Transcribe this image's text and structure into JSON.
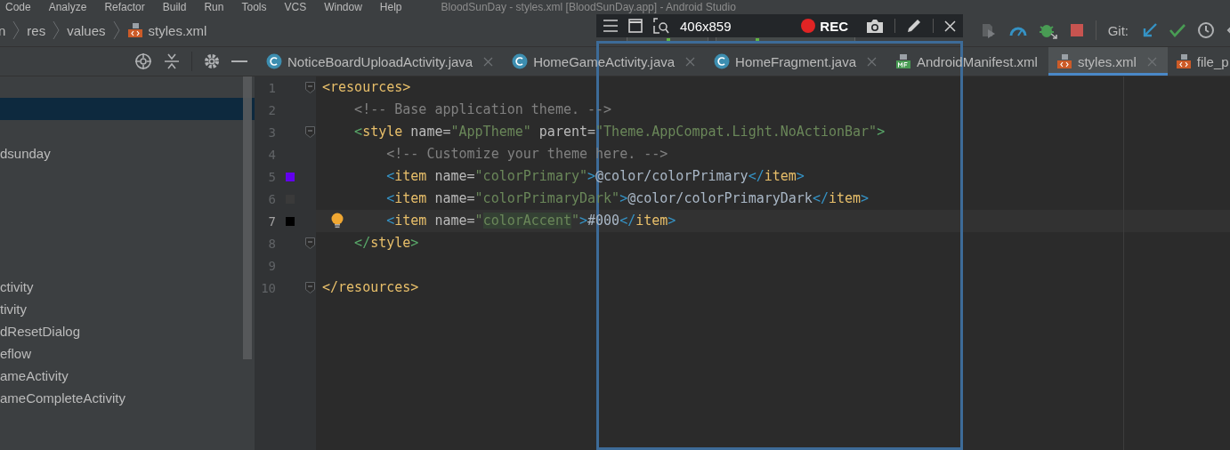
{
  "menu": [
    "Code",
    "Analyze",
    "Refactor",
    "Build",
    "Run",
    "Tools",
    "VCS",
    "Window",
    "Help"
  ],
  "window": {
    "title": "BloodSunDay - styles.xml [BloodSunDay.app] - Android Studio"
  },
  "breadcrumb": [
    {
      "label": "n",
      "kind": "folder"
    },
    {
      "label": "res",
      "kind": "folder"
    },
    {
      "label": "values",
      "kind": "folder"
    },
    {
      "label": "styles.xml",
      "kind": "xml"
    }
  ],
  "toolbar": {
    "git_label": "Git:"
  },
  "tabs": [
    {
      "label": "NoticeBoardUploadActivity.java",
      "kind": "class",
      "closable": true,
      "selected": false
    },
    {
      "label": "HomeGameActivity.java",
      "kind": "class",
      "closable": true,
      "selected": false
    },
    {
      "label": "HomeFragment.java",
      "kind": "class",
      "closable": true,
      "selected": false
    },
    {
      "label": "AndroidManifest.xml",
      "kind": "manifest",
      "closable": false,
      "selected": false
    },
    {
      "label": "styles.xml",
      "kind": "xml",
      "closable": true,
      "selected": true
    },
    {
      "label": "file_p",
      "kind": "xml",
      "closable": false,
      "selected": false
    }
  ],
  "project_tree": [
    {
      "selected": true
    },
    {
      "label": "dsunday",
      "selected": false
    },
    {
      "label": "ctivity",
      "selected": false
    },
    {
      "label": "tivity",
      "selected": false
    },
    {
      "label": "dResetDialog",
      "selected": false
    },
    {
      "label": "eflow",
      "selected": false
    },
    {
      "label": "ameActivity",
      "selected": false
    },
    {
      "label": "ameCompleteActivity",
      "selected": false
    }
  ],
  "editor": {
    "lines": [
      {
        "number": "1",
        "fold": true,
        "current": false,
        "tokens": [
          {
            "kind": "tag",
            "text": "<resources>"
          }
        ]
      },
      {
        "number": "2",
        "fold": false,
        "current": false,
        "tokens": [
          {
            "kind": "comment",
            "text": "    <!-- Base application theme. -->"
          }
        ]
      },
      {
        "number": "3",
        "fold": true,
        "current": false,
        "tokens": [
          {
            "kind": "bracket-outer",
            "text": "    <"
          },
          {
            "kind": "tag",
            "text": "style"
          },
          {
            "kind": "attr",
            "text": " name="
          },
          {
            "kind": "value",
            "text": "\"AppTheme\""
          },
          {
            "kind": "attr",
            "text": " parent="
          },
          {
            "kind": "value",
            "text": "\"Theme.AppCompat.Light.NoActionBar\""
          },
          {
            "kind": "bracket-outer",
            "text": ">"
          }
        ]
      },
      {
        "number": "4",
        "fold": false,
        "current": false,
        "tokens": [
          {
            "kind": "comment",
            "text": "        <!-- Customize your theme here. -->"
          }
        ]
      },
      {
        "number": "5",
        "fold": false,
        "current": false,
        "color": "#6200ee",
        "tokens": [
          {
            "kind": "bracket-inner",
            "text": "        <"
          },
          {
            "kind": "tag",
            "text": "item"
          },
          {
            "kind": "attr",
            "text": " name="
          },
          {
            "kind": "value",
            "text": "\"colorPrimary\""
          },
          {
            "kind": "bracket-inner",
            "text": ">"
          },
          {
            "kind": "text",
            "text": "@color/colorPrimary"
          },
          {
            "kind": "bracket-inner",
            "text": "</"
          },
          {
            "kind": "tag",
            "text": "item"
          },
          {
            "kind": "bracket-inner",
            "text": ">"
          }
        ]
      },
      {
        "number": "6",
        "fold": false,
        "current": false,
        "color": "#3a3a3a",
        "tokens": [
          {
            "kind": "bracket-inner",
            "text": "        <"
          },
          {
            "kind": "tag",
            "text": "item"
          },
          {
            "kind": "attr",
            "text": " name="
          },
          {
            "kind": "value",
            "text": "\"colorPrimaryDark\""
          },
          {
            "kind": "bracket-inner",
            "text": ">"
          },
          {
            "kind": "text",
            "text": "@color/colorPrimaryDark"
          },
          {
            "kind": "bracket-inner",
            "text": "</"
          },
          {
            "kind": "tag",
            "text": "item"
          },
          {
            "kind": "bracket-inner",
            "text": ">"
          }
        ]
      },
      {
        "number": "7",
        "fold": false,
        "current": true,
        "bulb": true,
        "color": "#000000",
        "tokens": [
          {
            "kind": "bracket-inner",
            "text": "        <"
          },
          {
            "kind": "tag",
            "text": "item"
          },
          {
            "kind": "attr",
            "text": " name="
          },
          {
            "kind": "value",
            "text": "\""
          },
          {
            "kind": "value-match",
            "text": "colorAccent"
          },
          {
            "kind": "value",
            "text": "\""
          },
          {
            "kind": "bracket-inner",
            "text": ">"
          },
          {
            "kind": "text",
            "text": "#000"
          },
          {
            "kind": "bracket-inner",
            "text": "</"
          },
          {
            "kind": "tag",
            "text": "item"
          },
          {
            "kind": "bracket-inner",
            "text": ">"
          }
        ]
      },
      {
        "number": "8",
        "fold": true,
        "current": false,
        "tokens": [
          {
            "kind": "bracket-outer",
            "text": "    </"
          },
          {
            "kind": "tag",
            "text": "style"
          },
          {
            "kind": "bracket-outer",
            "text": ">"
          }
        ]
      },
      {
        "number": "9",
        "fold": false,
        "current": false
      },
      {
        "number": "10",
        "fold": true,
        "current": false,
        "tokens": [
          {
            "kind": "tag",
            "text": "</resources>"
          }
        ]
      }
    ]
  },
  "recorder": {
    "size": "406x859",
    "rec_label": "REC",
    "recording": true
  }
}
